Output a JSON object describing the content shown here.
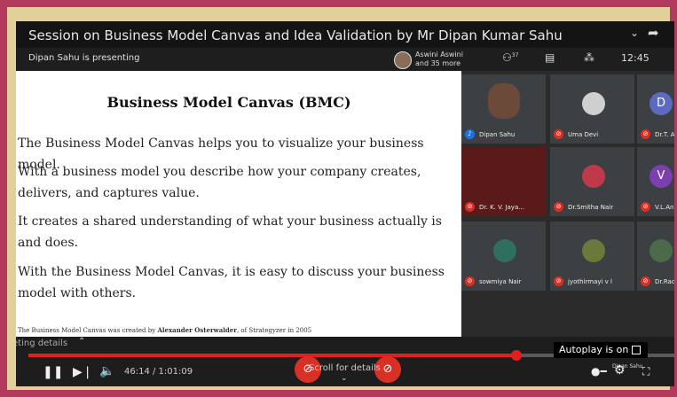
{
  "video": {
    "title": "Session on Business Model Canvas and Idea Validation by Mr Dipan Kumar Sahu",
    "presenting": "Dipan Sahu is presenting",
    "viewers_line1": "Aswini Aswini",
    "viewers_line2": "and 35 more",
    "people_count": "37",
    "clock": "12:45"
  },
  "slide": {
    "title": "Business Model Canvas (BMC)",
    "paragraphs": [
      "The Business Model Canvas helps you to visualize your business model.",
      "With a business model you describe how your company creates, delivers, and captures value.",
      "It creates a shared understanding of what your business actually is and does.",
      "With the Business Model Canvas, it is easy to discuss your business model with others."
    ],
    "footnote_pre": "The Business Model Canvas was created by ",
    "footnote_author": "Alexander Osterwalder",
    "footnote_post": ", of Strategyzer in 2005"
  },
  "participants": [
    {
      "name": "Dipan Sahu",
      "avatar": "",
      "color": "#6b4a3a"
    },
    {
      "name": "Uma Devi",
      "avatar": "",
      "color": "#cfcfcf"
    },
    {
      "name": "Dr.T. A",
      "avatar": "D",
      "color": "#5c6bc0"
    },
    {
      "name": "Dr. K. V. Jaya...",
      "avatar": "",
      "color": "#7a1f1f"
    },
    {
      "name": "Dr.Smitha Nair",
      "avatar": "",
      "color": "#c0394b"
    },
    {
      "name": "V.L.An",
      "avatar": "V",
      "color": "#7b3fb0"
    },
    {
      "name": "sowmiya Nair",
      "avatar": "",
      "color": "#2f6f5f"
    },
    {
      "name": "jyothirmayi v l",
      "avatar": "",
      "color": "#6a7a3a"
    },
    {
      "name": "Dr.Rad",
      "avatar": "",
      "color": "#4a6a4a"
    }
  ],
  "player": {
    "meeting_details": "eting details",
    "time": "46:14 / 1:01:09",
    "progress": 0.755,
    "scroll_hint": "Scroll for details",
    "autoplay": "Autoplay is on",
    "presenter_small": "Dipan Sahu"
  }
}
